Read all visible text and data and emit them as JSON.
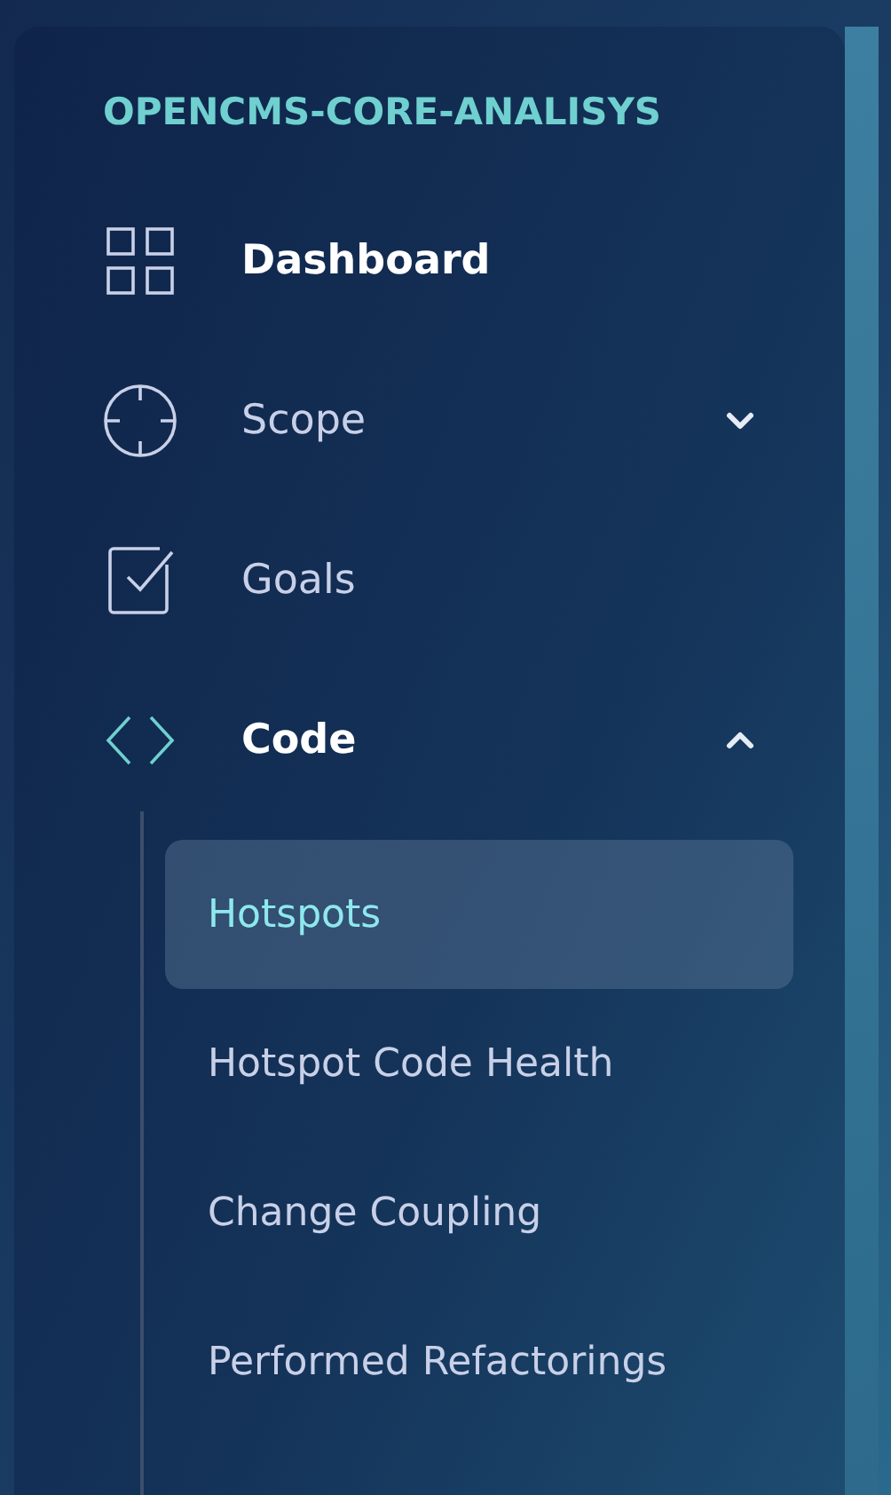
{
  "project": {
    "title": "OPENCMS-CORE-ANALISYS"
  },
  "nav": [
    {
      "label": "Dashboard",
      "active": true
    },
    {
      "label": "Scope",
      "active": false,
      "expanded": false
    },
    {
      "label": "Goals",
      "active": false
    },
    {
      "label": "Code",
      "active": true,
      "expanded": true,
      "children": [
        {
          "label": "Hotspots",
          "selected": true
        },
        {
          "label": "Hotspot Code Health",
          "selected": false
        },
        {
          "label": "Change Coupling",
          "selected": false
        },
        {
          "label": "Performed Refactorings",
          "selected": false
        }
      ]
    }
  ]
}
